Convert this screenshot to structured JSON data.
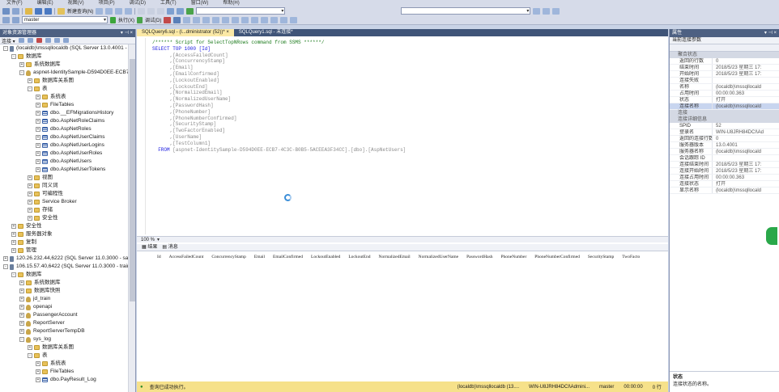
{
  "menubar": {
    "items": [
      "文件(F)",
      "编辑(E)",
      "视图(V)",
      "项目(P)",
      "调试(D)",
      "工具(T)",
      "窗口(W)",
      "帮助(H)"
    ]
  },
  "toolbar": {
    "new_query": "新建查询(N)",
    "db_select": "master",
    "execute": "执行(X)",
    "debug": "调试(D)"
  },
  "object_explorer": {
    "title": "对象资源管理器",
    "connect": "连接 ▾",
    "nodes": [
      {
        "level": 0,
        "icon": "server",
        "expand": "-",
        "label": "(localdb)\\mssqllocaldb (SQL Server 13.0.4001 - "
      },
      {
        "level": 1,
        "icon": "folder",
        "expand": "-",
        "label": "数据库"
      },
      {
        "level": 2,
        "icon": "folder",
        "expand": "+",
        "label": "系统数据库"
      },
      {
        "level": 2,
        "icon": "db",
        "expand": "-",
        "label": "aspnet-IdentitySample-D594D0EE-ECB7-4"
      },
      {
        "level": 3,
        "icon": "folder",
        "expand": "+",
        "label": "数据库关系图"
      },
      {
        "level": 3,
        "icon": "folder",
        "expand": "-",
        "label": "表"
      },
      {
        "level": 4,
        "icon": "folder",
        "expand": "+",
        "label": "系统表"
      },
      {
        "level": 4,
        "icon": "folder",
        "expand": "+",
        "label": "FileTables"
      },
      {
        "level": 4,
        "icon": "table",
        "expand": "+",
        "label": "dbo.__EFMigrationsHistory"
      },
      {
        "level": 4,
        "icon": "table",
        "expand": "+",
        "label": "dbo.AspNetRoleClaims"
      },
      {
        "level": 4,
        "icon": "table",
        "expand": "+",
        "label": "dbo.AspNetRoles"
      },
      {
        "level": 4,
        "icon": "table",
        "expand": "+",
        "label": "dbo.AspNetUserClaims"
      },
      {
        "level": 4,
        "icon": "table",
        "expand": "+",
        "label": "dbo.AspNetUserLogins"
      },
      {
        "level": 4,
        "icon": "table",
        "expand": "+",
        "label": "dbo.AspNetUserRoles"
      },
      {
        "level": 4,
        "icon": "table",
        "expand": "+",
        "label": "dbo.AspNetUsers"
      },
      {
        "level": 4,
        "icon": "table",
        "expand": "+",
        "label": "dbo.AspNetUserTokens"
      },
      {
        "level": 3,
        "icon": "folder",
        "expand": "+",
        "label": "视图"
      },
      {
        "level": 3,
        "icon": "folder",
        "expand": "+",
        "label": "同义词"
      },
      {
        "level": 3,
        "icon": "folder",
        "expand": "+",
        "label": "可编程性"
      },
      {
        "level": 3,
        "icon": "folder",
        "expand": "+",
        "label": "Service Broker"
      },
      {
        "level": 3,
        "icon": "folder",
        "expand": "+",
        "label": "存储"
      },
      {
        "level": 3,
        "icon": "folder",
        "expand": "+",
        "label": "安全性"
      },
      {
        "level": 1,
        "icon": "folder",
        "expand": "+",
        "label": "安全性"
      },
      {
        "level": 1,
        "icon": "folder",
        "expand": "+",
        "label": "服务器对象"
      },
      {
        "level": 1,
        "icon": "folder",
        "expand": "+",
        "label": "复制"
      },
      {
        "level": 1,
        "icon": "folder",
        "expand": "+",
        "label": "管理"
      },
      {
        "level": 0,
        "icon": "server",
        "expand": "+",
        "label": "120.26.232.44,6222 (SQL Server 11.0.3000 - sa)"
      },
      {
        "level": 0,
        "icon": "server",
        "expand": "-",
        "label": "106.15.57.40,6422 (SQL Server 11.0.3000 - trainl"
      },
      {
        "level": 1,
        "icon": "folder",
        "expand": "-",
        "label": "数据库"
      },
      {
        "level": 2,
        "icon": "folder",
        "expand": "+",
        "label": "系统数据库"
      },
      {
        "level": 2,
        "icon": "folder",
        "expand": "+",
        "label": "数据库快照"
      },
      {
        "level": 2,
        "icon": "db",
        "expand": "+",
        "label": "jd_train"
      },
      {
        "level": 2,
        "icon": "db",
        "expand": "+",
        "label": "openapi"
      },
      {
        "level": 2,
        "icon": "db",
        "expand": "+",
        "label": "PassengerAccount"
      },
      {
        "level": 2,
        "icon": "db",
        "expand": "+",
        "label": "ReportServer"
      },
      {
        "level": 2,
        "icon": "db",
        "expand": "+",
        "label": "ReportServerTempDB"
      },
      {
        "level": 2,
        "icon": "db",
        "expand": "-",
        "label": "sys_log"
      },
      {
        "level": 3,
        "icon": "folder",
        "expand": "+",
        "label": "数据库关系图"
      },
      {
        "level": 3,
        "icon": "folder",
        "expand": "-",
        "label": "表"
      },
      {
        "level": 4,
        "icon": "folder",
        "expand": "+",
        "label": "系统表"
      },
      {
        "level": 4,
        "icon": "folder",
        "expand": "+",
        "label": "FileTables"
      },
      {
        "level": 4,
        "icon": "table",
        "expand": "+",
        "label": "dbo.PayResult_Log"
      }
    ]
  },
  "tabs": [
    {
      "label": "SQLQuery6.sql - (l...dministrator (52))*  ×",
      "active": true
    },
    {
      "label": "SQLQuery1.sql - 未连接*",
      "active": false
    }
  ],
  "editor": {
    "comment": "/****** Script for SelectTopNRows command from SSMS  ******/",
    "select": "SELECT TOP 1000 [Id]",
    "columns": [
      ",[AccessFailedCount]",
      ",[ConcurrencyStamp]",
      ",[Email]",
      ",[EmailConfirmed]",
      ",[LockoutEnabled]",
      ",[LockoutEnd]",
      ",[NormalizedEmail]",
      ",[NormalizedUserName]",
      ",[PasswordHash]",
      ",[PhoneNumber]",
      ",[PhoneNumberConfirmed]",
      ",[SecurityStamp]",
      ",[TwoFactorEnabled]",
      ",[UserName]",
      ",[TestColumn1]"
    ],
    "from_kw": "FROM",
    "from_obj": "[aspnet-IdentitySample-D594D0EE-ECB7-4C3C-B0B5-5ACEEA3F34CC].[dbo].[AspNetUsers]"
  },
  "zoom": "100 %",
  "result_tabs": {
    "results": "结果",
    "messages": "消息"
  },
  "result_columns": [
    "Id",
    "AccessFailedCount",
    "ConcurrencyStamp",
    "Email",
    "EmailConfirmed",
    "LockoutEnabled",
    "LockoutEnd",
    "NormalizedEmail",
    "NormalizedUserName",
    "PasswordHash",
    "PhoneNumber",
    "PhoneNumberConfirmed",
    "SecurityStamp",
    "TwoFacto"
  ],
  "status": {
    "message": "查询已成功执行。",
    "server": "(localdb)\\mssqllocaldb (13....",
    "user": "WIN-U8JRH84DCI\\Admini...",
    "database": "master",
    "elapsed": "00:00:00",
    "rows": "0 行"
  },
  "properties": {
    "title": "属性",
    "selector": "当前连接参数",
    "sections": [
      {
        "name": "聚合状态",
        "rows": [
          {
            "k": "返回的行数",
            "v": "0"
          },
          {
            "k": "结束时间",
            "v": "2018/5/23 星期三 17:"
          },
          {
            "k": "开始时间",
            "v": "2018/5/23 星期三 17:"
          },
          {
            "k": "连接失败",
            "v": ""
          },
          {
            "k": "名称",
            "v": "(localdb)\\mssqllocald"
          },
          {
            "k": "占用时间",
            "v": "00:00:00.363"
          },
          {
            "k": "状态",
            "v": "打开"
          },
          {
            "k": "连接名称",
            "v": "(localdb)\\mssqllocald",
            "sel": true
          }
        ]
      },
      {
        "name": "连接",
        "rows": []
      },
      {
        "name": "连接详细信息",
        "rows": [
          {
            "k": "SPID",
            "v": "52"
          },
          {
            "k": "登录名",
            "v": "WIN-U8JRH84DCI\\Ad"
          },
          {
            "k": "返回的连接行数",
            "v": "0"
          },
          {
            "k": "服务器版本",
            "v": "13.0.4001"
          },
          {
            "k": "服务器名称",
            "v": "(localdb)\\mssqllocald"
          },
          {
            "k": "会话跟踪 ID",
            "v": ""
          },
          {
            "k": "连接结束时间",
            "v": "2018/5/23 星期三 17:"
          },
          {
            "k": "连接开始时间",
            "v": "2018/5/23 星期三 17:"
          },
          {
            "k": "连接占用时间",
            "v": "00:00:00.363"
          },
          {
            "k": "连接状态",
            "v": "打开"
          },
          {
            "k": "显示名称",
            "v": "(localdb)\\mssqllocald"
          }
        ]
      }
    ],
    "desc_title": "状态",
    "desc_text": "连接状态的名称。"
  }
}
